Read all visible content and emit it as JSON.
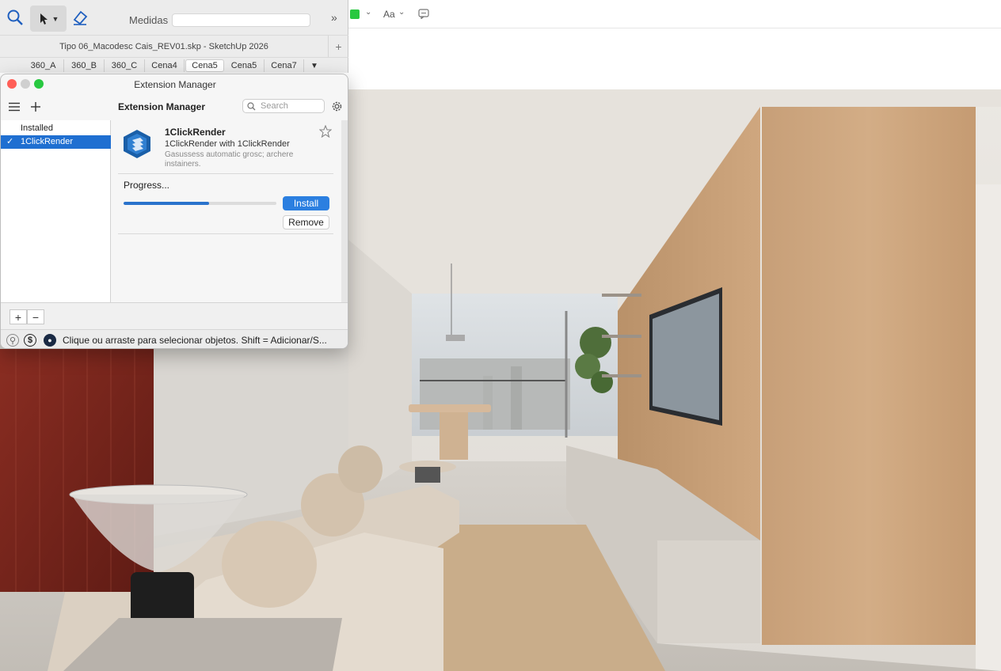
{
  "toolbar": {
    "measurements_label": "Medidas",
    "measurements_value": "",
    "overflow_icon": "chevron-double-right-icon"
  },
  "window": {
    "title": "Tipo 06_Macodesc Cais_REV01.skp - SketchUp 2026"
  },
  "scene_tabs": [
    "360_A",
    "360_B",
    "360_C",
    "Cena4",
    "Cena5",
    "Cena5",
    "Cena7"
  ],
  "active_scene_index": 4,
  "right_toolbar": {
    "font_label": "Aa",
    "accent": "#28c840"
  },
  "extension_manager": {
    "window_title": "Extension Manager",
    "header_title": "Extension Manager",
    "search_placeholder": "Search",
    "sidebar": [
      {
        "label": "Installed",
        "selected": false
      },
      {
        "label": "1ClickRender",
        "selected": true
      }
    ],
    "extension": {
      "name": "1ClickRender",
      "subtitle": "1ClickRender with 1ClickRender",
      "description": "Gasussess automatic grosc; archere instainers."
    },
    "progress_label": "Progress...",
    "progress_fraction": 0.56,
    "install_label": "Install",
    "remove_label": "Remove",
    "footer_add": "+",
    "footer_remove": "−",
    "accent": "#1f6fd1"
  },
  "status_bar": {
    "message": "Clique ou arraste para selecionar objetos. Shift = Adicionar/S..."
  }
}
